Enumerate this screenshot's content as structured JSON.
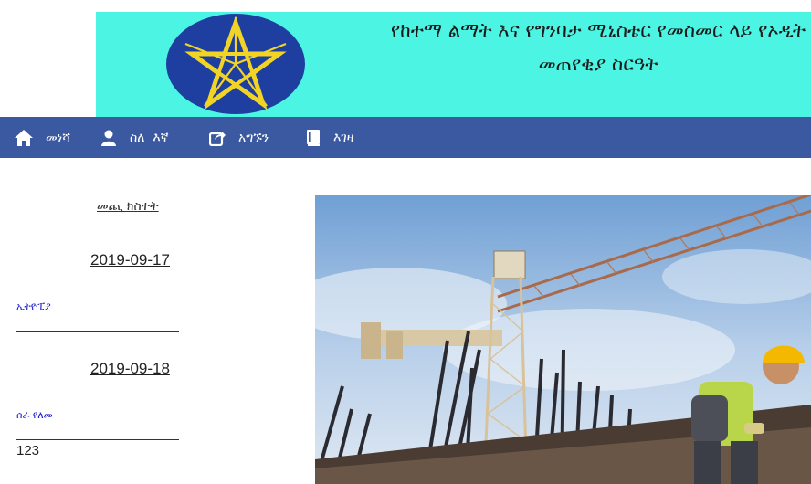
{
  "header": {
    "title_line1": "የከተማ ልማት እና የግንባታ ሚኒስቴር የመስመር ላይ የኦዲት",
    "title_line2": "መጠየቂያ ስርዓት",
    "background_color": "#4cf5e3",
    "emblem": "ethiopia-emblem"
  },
  "nav": {
    "background_color": "#3a59a0",
    "items": [
      {
        "label": "መነሻ",
        "icon": "home-icon"
      },
      {
        "label": "ስለ  እኛ",
        "icon": "user-icon"
      },
      {
        "label": "አግኙን",
        "icon": "share-icon"
      },
      {
        "label": "እገዛ",
        "icon": "book-icon"
      }
    ]
  },
  "sidebar": {
    "title": "መጪ ክስተት",
    "news": [
      {
        "date": "2019-09-17",
        "title": "ኢትዮፒያ",
        "divider": "______________________",
        "body": ""
      },
      {
        "date": "2019-09-18",
        "title": "ሰራ የለመ",
        "divider": "______________________",
        "body": "123"
      }
    ]
  },
  "hero": {
    "image": "construction-crane-worker-photo"
  }
}
